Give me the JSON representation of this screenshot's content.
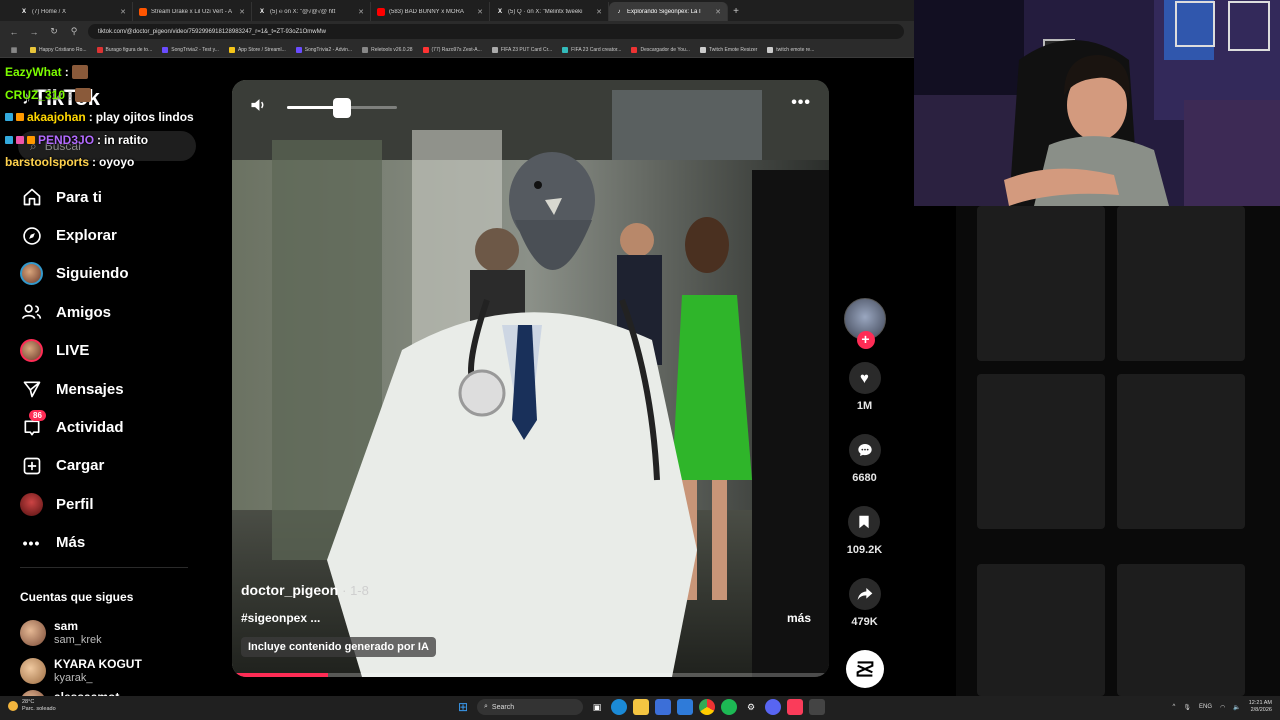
{
  "browser": {
    "tabs": [
      {
        "title": "(7) Home / X",
        "favicon": "x-icon",
        "active": false
      },
      {
        "title": "Stream Drake x Lil Uzi Vert - A",
        "favicon": "soundcloud-icon",
        "active": false
      },
      {
        "title": "(5) ℮ on X: \"@√@√@ htt",
        "favicon": "x-icon",
        "active": false
      },
      {
        "title": "(583) BAD BUNNY x MORA",
        "favicon": "youtube-icon",
        "active": false
      },
      {
        "title": "(5) Q · on X: \"Melintx tweeki",
        "favicon": "x-icon",
        "active": false
      },
      {
        "title": "Explorando Sigeonpex: La I",
        "favicon": "tiktok-icon",
        "active": true
      }
    ],
    "new_tab": "+",
    "url": "tiktok.com/@doctor_pigeon/video/7592996918128983247_r=1&_t=ZT-93oZ1OmwMw",
    "bookmarks": [
      "Happy Cristiano Ro...",
      "Burago figura de to...",
      "SongTrivia2 - Test y...",
      "App Store / Streaml...",
      "SongTrivia2 - Advin...",
      "Reletools v26.0.28",
      "(77) Razo97s Zest-A...",
      "FIFA 23 PUT Card Cr...",
      "FIFA 23 Card creator...",
      "Descargador de You...",
      "Twitch Emote Resizer",
      "twitch emote re..."
    ]
  },
  "chat": [
    {
      "user": "EazyWhat",
      "msg": "",
      "color": "#7cfc00"
    },
    {
      "user": "CRUZ_310",
      "msg": "",
      "color": "#7cfc00"
    },
    {
      "user": "akaajohan",
      "msg": "play ojitos lindos",
      "color": "#ffd700"
    },
    {
      "user": "PEND3JO",
      "msg": "in ratito",
      "color": "#b36bff"
    },
    {
      "user": "barstoolsports",
      "msg": "oyoyo",
      "color": "#ffd24d"
    }
  ],
  "tiktok": {
    "logo": "TikTok",
    "search_placeholder": "Buscar",
    "nav": [
      {
        "label": "Para ti",
        "icon": "home-icon"
      },
      {
        "label": "Explorar",
        "icon": "compass-icon"
      },
      {
        "label": "Siguiendo",
        "icon": "avatar-icon"
      },
      {
        "label": "Amigos",
        "icon": "friends-icon"
      },
      {
        "label": "LIVE",
        "icon": "live-icon"
      },
      {
        "label": "Mensajes",
        "icon": "send-icon"
      },
      {
        "label": "Actividad",
        "icon": "inbox-icon",
        "badge": "86"
      },
      {
        "label": "Cargar",
        "icon": "upload-icon"
      },
      {
        "label": "Perfil",
        "icon": "profile-icon"
      },
      {
        "label": "Más",
        "icon": "more-icon"
      }
    ],
    "following_title": "Cuentas que sigues",
    "following": [
      {
        "name": "sam",
        "handle": "sam_krek"
      },
      {
        "name": "KYARA KOGUT",
        "handle": "kyarak_"
      },
      {
        "name": "alessaamot",
        "handle": ""
      }
    ],
    "video": {
      "author": "doctor_pigeon",
      "date": "1-8",
      "hashtags": "#sigeonpex ...",
      "more": "más",
      "ai_label": "Incluye contenido generado por IA",
      "volume_level": 0.5,
      "progress": 0.16
    },
    "actions": {
      "likes": "1M",
      "comments": "6680",
      "saves": "109.2K",
      "shares": "479K"
    }
  },
  "taskbar": {
    "weather_temp": "28°C",
    "weather_desc": "Parc. soleado",
    "search": "Search",
    "lang": "ENG",
    "time": "12:21 AM",
    "date": "2/8/2026"
  },
  "colors": {
    "accent": "#fe2c55",
    "bg": "#000000"
  }
}
